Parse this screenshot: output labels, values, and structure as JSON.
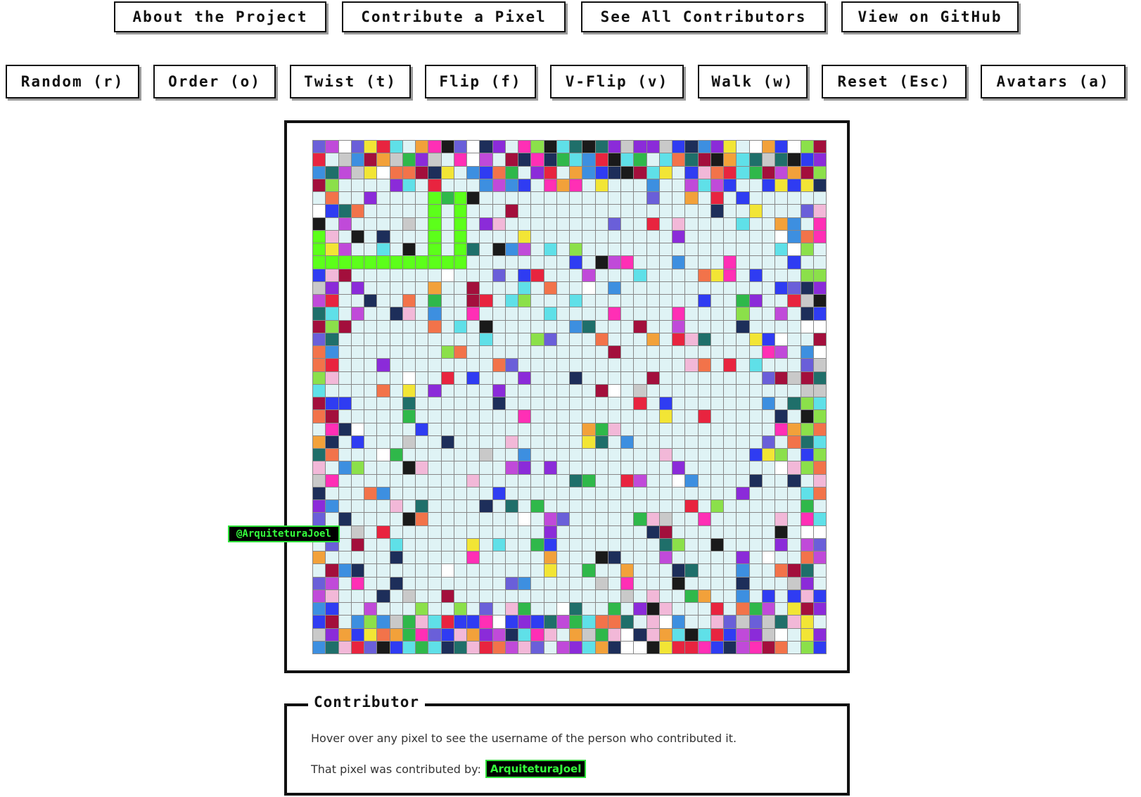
{
  "nav": {
    "about": "About the Project",
    "contribute": "Contribute a Pixel",
    "contributors": "See All Contributors",
    "github": "View on GitHub"
  },
  "controls": {
    "random": "Random (r)",
    "order": "Order (o)",
    "twist": "Twist (t)",
    "flip": "Flip (f)",
    "vflip": "V-Flip (v)",
    "walk": "Walk (w)",
    "reset": "Reset (Esc)",
    "avatars": "Avatars (a)"
  },
  "tooltip": {
    "username": "@ArquiteturaJoel"
  },
  "contributor": {
    "legend": "Contributor",
    "help": "Hover over any pixel to see the username of the person who contributed it.",
    "by_label": "That pixel was contributed by:",
    "username": "ArquiteturaJoel"
  },
  "grid": {
    "size": 40,
    "empty_color": "#dff3f5",
    "palette": [
      "#e8243f",
      "#2f3cf2",
      "#5fe0e8",
      "#f2a13a",
      "#1a1a1a",
      "#ff2fb5",
      "#3d8fe0",
      "#8b2bd9",
      "#2fb84a",
      "#f2e535",
      "#a30f3c",
      "#1f6f6a",
      "#f2b8d8",
      "#6a5fd9",
      "#c9c9c9",
      "#ffffff",
      "#c04ad9",
      "#f2734a",
      "#1d2e5a",
      "#8be04a"
    ],
    "bright_green": "#5cff1a"
  },
  "colors": {
    "accent_green": "#35ff3d",
    "border": "#111111"
  }
}
